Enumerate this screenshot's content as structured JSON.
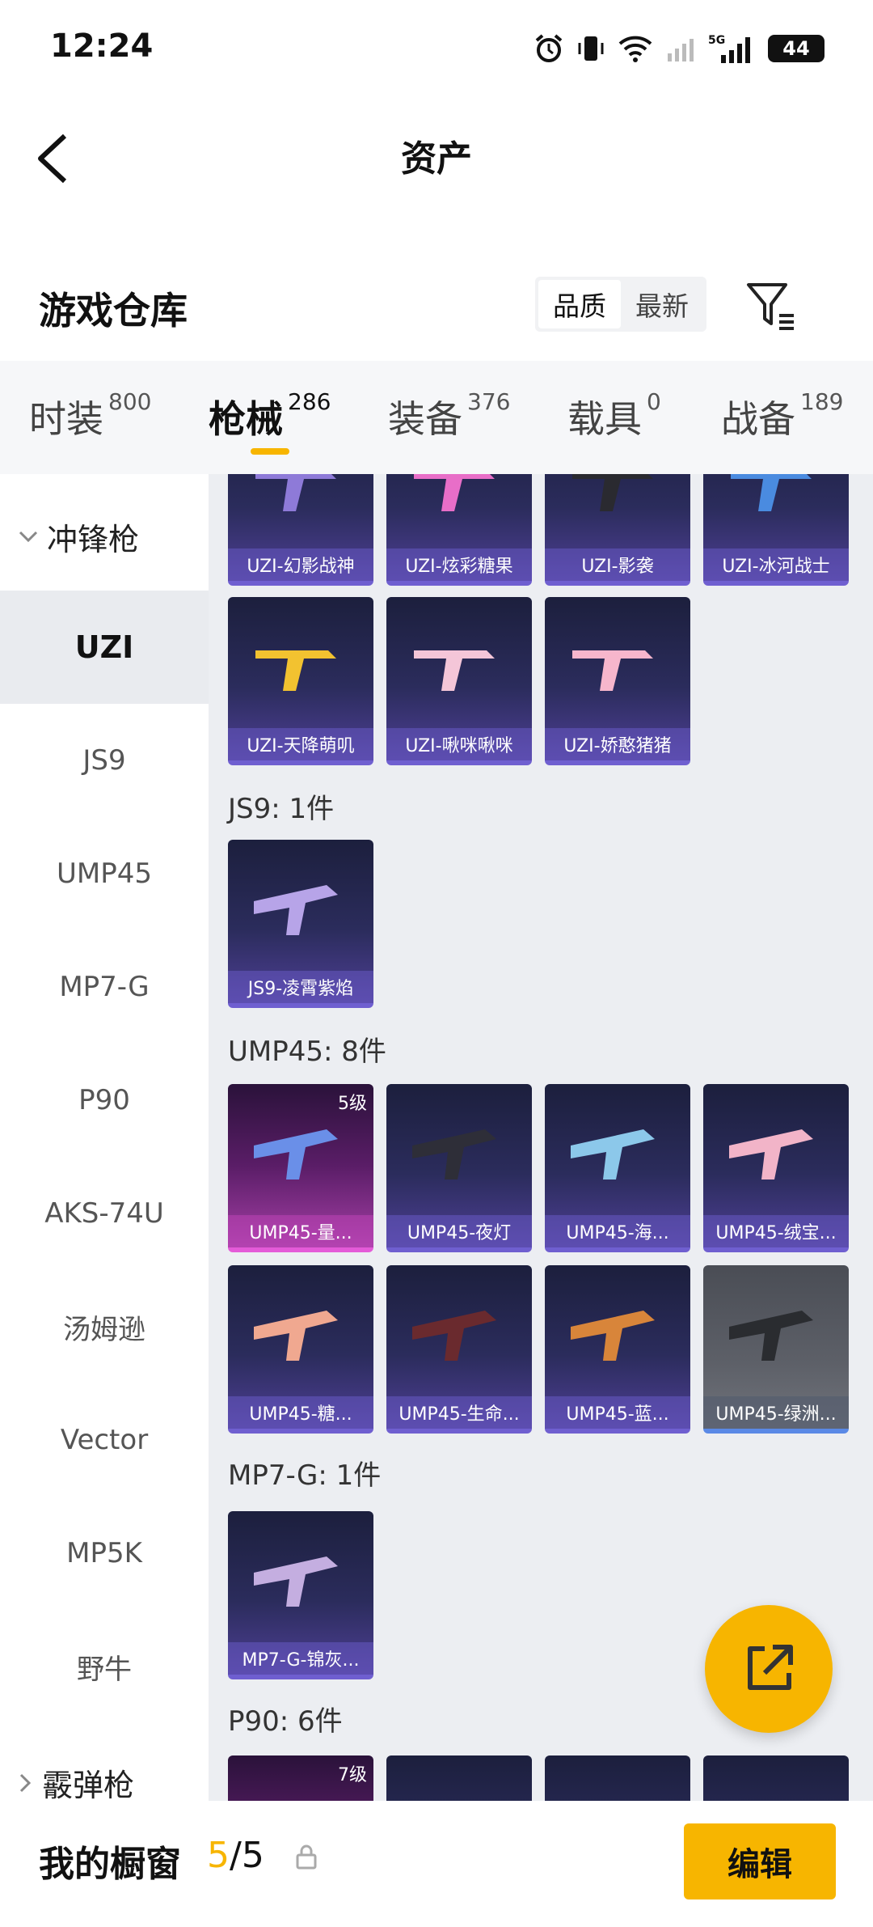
{
  "status": {
    "time": "12:24",
    "network": "5G",
    "battery": "44"
  },
  "nav": {
    "title": "资产"
  },
  "header": {
    "title": "游戏仓库",
    "sort": [
      "品质",
      "最新"
    ]
  },
  "tabs": [
    {
      "label": "时装",
      "count": "800"
    },
    {
      "label": "枪械",
      "count": "286"
    },
    {
      "label": "装备",
      "count": "376"
    },
    {
      "label": "载具",
      "count": "0"
    },
    {
      "label": "战备",
      "count": "189"
    }
  ],
  "sidebar": {
    "group1": "冲锋枪",
    "items": [
      "UZI",
      "JS9",
      "UMP45",
      "MP7-G",
      "P90",
      "AKS-74U",
      "汤姆逊",
      "Vector",
      "MP5K",
      "野牛"
    ],
    "group2": "霰弹枪"
  },
  "groups": {
    "uzi_row1": [
      "UZI-幻影战神",
      "UZI-炫彩糖果",
      "UZI-影袭",
      "UZI-冰河战士"
    ],
    "uzi_row2": [
      "UZI-天降萌叽",
      "UZI-啾咪啾咪",
      "UZI-娇憨猪猪"
    ],
    "js9_label": "JS9: 1件",
    "js9_items": [
      "JS9-凌霄紫焰"
    ],
    "ump45_label": "UMP45: 8件",
    "ump45_row1": [
      "UMP45-量...",
      "UMP45-夜灯",
      "UMP45-海...",
      "UMP45-绒宝..."
    ],
    "ump45_row1_level": "5级",
    "ump45_row2": [
      "UMP45-糖...",
      "UMP45-生命...",
      "UMP45-蓝...",
      "UMP45-绿洲..."
    ],
    "mp7_label": "MP7-G: 1件",
    "mp7_items": [
      "MP7-G-锦灰..."
    ],
    "p90_label": "P90: 6件",
    "p90_level": "7级"
  },
  "bottom": {
    "title": "我的橱窗",
    "current": "5",
    "total": "/5",
    "edit": "编辑"
  },
  "colors": {
    "accent": "#f7b500",
    "card": "#2b2c5c",
    "card_pink": "#a43fa5"
  }
}
